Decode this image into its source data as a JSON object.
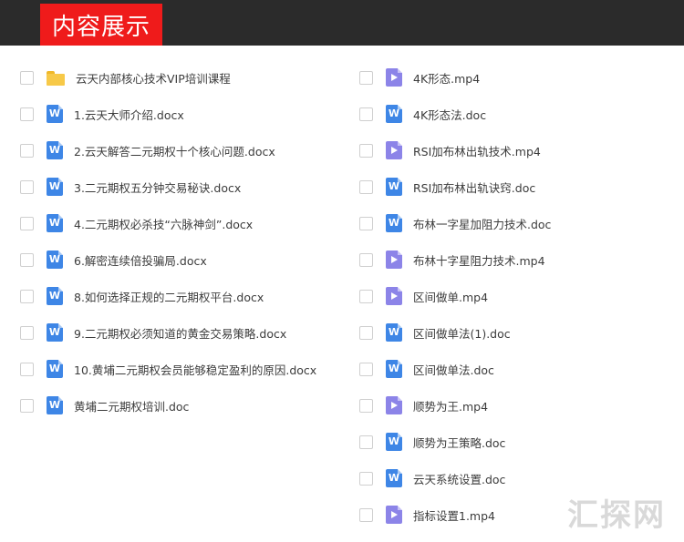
{
  "header": {
    "title": "内容展示"
  },
  "left_files": [
    {
      "icon": "folder-icon",
      "name": "云天内部核心技术VIP培训课程"
    },
    {
      "icon": "word-doc-icon",
      "name": "1.云天大师介绍.docx"
    },
    {
      "icon": "word-doc-icon",
      "name": "2.云天解答二元期权十个核心问题.docx"
    },
    {
      "icon": "word-doc-icon",
      "name": "3.二元期权五分钟交易秘诀.docx"
    },
    {
      "icon": "word-doc-icon",
      "name": "4.二元期权必杀技“六脉神剑”.docx"
    },
    {
      "icon": "word-doc-icon",
      "name": "6.解密连续倍投骗局.docx"
    },
    {
      "icon": "word-doc-icon",
      "name": "8.如何选择正规的二元期权平台.docx"
    },
    {
      "icon": "word-doc-icon",
      "name": "9.二元期权必须知道的黄金交易策略.docx"
    },
    {
      "icon": "word-doc-icon",
      "name": "10.黄埔二元期权会员能够稳定盈利的原因.docx"
    },
    {
      "icon": "word-doc-icon",
      "name": "黄埔二元期权培训.doc"
    }
  ],
  "right_files": [
    {
      "icon": "video-file-icon",
      "name": "4K形态.mp4"
    },
    {
      "icon": "word-doc-icon",
      "name": "4K形态法.doc"
    },
    {
      "icon": "video-file-icon",
      "name": "RSI加布林出轨技术.mp4"
    },
    {
      "icon": "word-doc-icon",
      "name": "RSI加布林出轨诀窍.doc"
    },
    {
      "icon": "word-doc-icon",
      "name": "布林一字星加阻力技术.doc"
    },
    {
      "icon": "video-file-icon",
      "name": "布林十字星阻力技术.mp4"
    },
    {
      "icon": "video-file-icon",
      "name": "区间做单.mp4"
    },
    {
      "icon": "word-doc-icon",
      "name": "区间做单法(1).doc"
    },
    {
      "icon": "word-doc-icon",
      "name": "区间做单法.doc"
    },
    {
      "icon": "video-file-icon",
      "name": "顺势为王.mp4"
    },
    {
      "icon": "word-doc-icon",
      "name": "顺势为王策略.doc"
    },
    {
      "icon": "word-doc-icon",
      "name": "云天系统设置.doc"
    },
    {
      "icon": "video-file-icon",
      "name": "指标设置1.mp4"
    }
  ],
  "watermark": "汇探网",
  "colors": {
    "header_bg": "#2b2b2b",
    "title_bg": "#ef1b1b",
    "word_icon": "#3e86e6",
    "video_icon": "#8c84e8",
    "folder_icon": "#f7c948"
  }
}
